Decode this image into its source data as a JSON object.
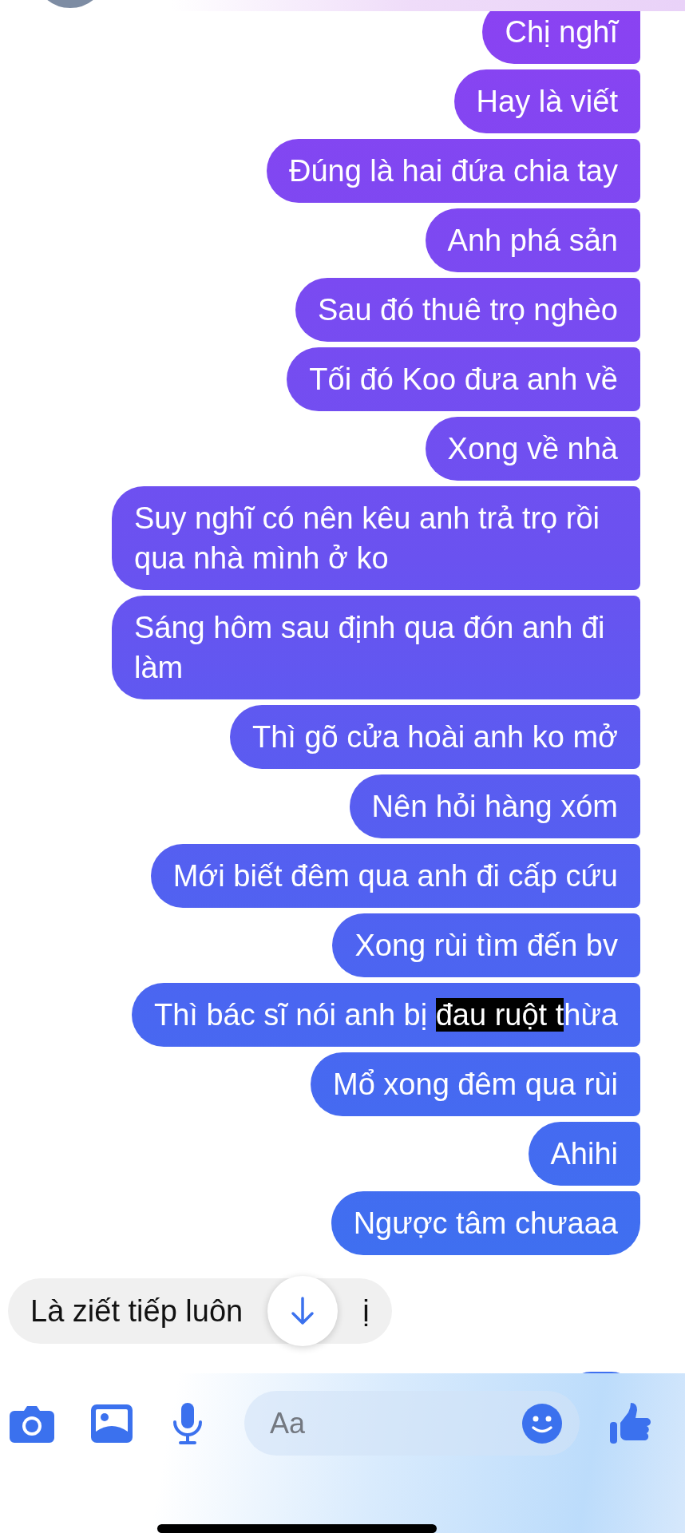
{
  "messages": [
    {
      "kind": "sent",
      "segments": [
        {
          "text": "Chị nghĩ",
          "highlighted": false
        }
      ]
    },
    {
      "kind": "sent",
      "segments": [
        {
          "text": "Hay là viết",
          "highlighted": false
        }
      ]
    },
    {
      "kind": "sent",
      "segments": [
        {
          "text": "Đúng là hai đứa chia tay",
          "highlighted": false
        }
      ]
    },
    {
      "kind": "sent",
      "segments": [
        {
          "text": "Anh phá sản",
          "highlighted": false
        }
      ]
    },
    {
      "kind": "sent",
      "segments": [
        {
          "text": "Sau đó thuê trọ nghèo",
          "highlighted": false
        }
      ]
    },
    {
      "kind": "sent",
      "segments": [
        {
          "text": "Tối đó Koo đưa anh về",
          "highlighted": false
        }
      ]
    },
    {
      "kind": "sent",
      "segments": [
        {
          "text": "Xong về nhà",
          "highlighted": false
        }
      ]
    },
    {
      "kind": "sent",
      "segments": [
        {
          "text": "Suy nghĩ có nên kêu anh trả trọ rồi qua nhà mình ở ko",
          "highlighted": false
        }
      ]
    },
    {
      "kind": "sent",
      "segments": [
        {
          "text": "Sáng hôm sau định qua đón anh đi làm",
          "highlighted": false
        }
      ]
    },
    {
      "kind": "sent",
      "segments": [
        {
          "text": "Thì gõ cửa hoài anh ko mở",
          "highlighted": false
        }
      ]
    },
    {
      "kind": "sent",
      "segments": [
        {
          "text": "Nên hỏi hàng xóm",
          "highlighted": false
        }
      ]
    },
    {
      "kind": "sent",
      "segments": [
        {
          "text": "Mới biết đêm qua anh đi cấp cứu",
          "highlighted": false
        }
      ]
    },
    {
      "kind": "sent",
      "segments": [
        {
          "text": "Xong rùi tìm đến bv",
          "highlighted": false
        }
      ]
    },
    {
      "kind": "sent",
      "segments": [
        {
          "text": "Thì bác sĩ nói anh bị ",
          "highlighted": false
        },
        {
          "text": "đau ruột t",
          "highlighted": true
        },
        {
          "text": "hừa",
          "highlighted": false
        }
      ]
    },
    {
      "kind": "sent",
      "segments": [
        {
          "text": "Mổ xong đêm qua rùi",
          "highlighted": false
        }
      ]
    },
    {
      "kind": "sent",
      "segments": [
        {
          "text": "Ahihi",
          "highlighted": false
        }
      ]
    },
    {
      "kind": "sent",
      "segments": [
        {
          "text": "Ngược tâm chưaaa",
          "highlighted": false
        }
      ]
    },
    {
      "kind": "received",
      "segments": [
        {
          "text": "Là ziết tiếp luôn",
          "highlighted": false
        },
        {
          "text": "ị",
          "highlighted": false
        }
      ]
    }
  ],
  "composer": {
    "placeholder": "Aa"
  }
}
